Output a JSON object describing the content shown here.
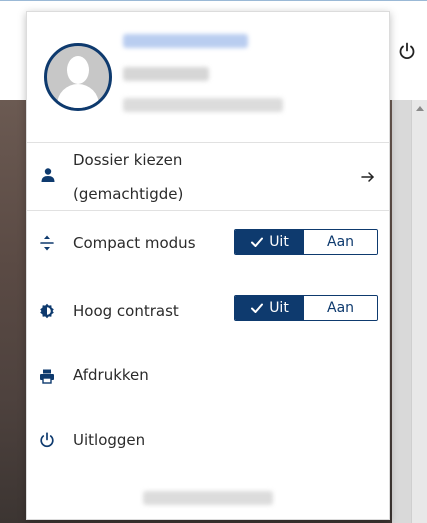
{
  "colors": {
    "accent": "#0e3a6e",
    "background_overlay": "#5a4a44"
  },
  "menu": {
    "profile": {
      "avatar_icon": "user-avatar-icon"
    },
    "items": [
      {
        "icon": "user-icon",
        "label_line1": "Dossier kiezen",
        "label_line2": "(gemachtigde)",
        "action_icon": "arrow-right-icon"
      },
      {
        "icon": "compact-icon",
        "label": "Compact modus",
        "toggle": {
          "on_label": "Uit",
          "off_label": "Aan",
          "selected": "Uit"
        }
      },
      {
        "icon": "contrast-icon",
        "label": "Hoog contrast",
        "toggle": {
          "on_label": "Uit",
          "off_label": "Aan",
          "selected": "Uit"
        }
      },
      {
        "icon": "printer-icon",
        "label": "Afdrukken"
      },
      {
        "icon": "power-icon",
        "label": "Uitloggen"
      }
    ]
  }
}
